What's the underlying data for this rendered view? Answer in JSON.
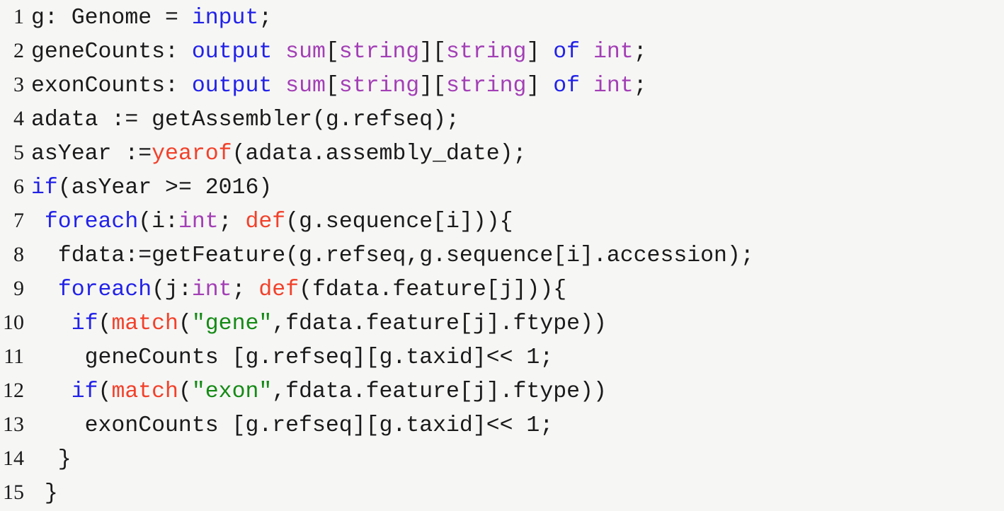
{
  "editor": {
    "background_color": "#f6f6f5",
    "default_text_color": "#1a1a1a",
    "language": "BoaLang"
  },
  "palette": {
    "plain": "#1a1a1a",
    "keyword": "#2222e8",
    "type": "#a33fb5",
    "builtin": "#f2412a",
    "string": "#158a15"
  },
  "lines": [
    {
      "number": "1",
      "text": "g: Genome = input;",
      "tokens": [
        {
          "t": "g: Genome = ",
          "c": "plain"
        },
        {
          "t": "input",
          "c": "keyword"
        },
        {
          "t": ";",
          "c": "plain"
        }
      ]
    },
    {
      "number": "2",
      "text": "geneCounts: output sum[string][string] of int;",
      "tokens": [
        {
          "t": "geneCounts: ",
          "c": "plain"
        },
        {
          "t": "output",
          "c": "keyword"
        },
        {
          "t": " ",
          "c": "plain"
        },
        {
          "t": "sum",
          "c": "type"
        },
        {
          "t": "[",
          "c": "plain"
        },
        {
          "t": "string",
          "c": "type"
        },
        {
          "t": "]",
          "c": "plain"
        },
        {
          "t": "[",
          "c": "plain"
        },
        {
          "t": "string",
          "c": "type"
        },
        {
          "t": "]",
          "c": "plain"
        },
        {
          "t": " ",
          "c": "plain"
        },
        {
          "t": "of",
          "c": "keyword"
        },
        {
          "t": " ",
          "c": "plain"
        },
        {
          "t": "int",
          "c": "type"
        },
        {
          "t": ";",
          "c": "plain"
        }
      ]
    },
    {
      "number": "3",
      "text": "exonCounts: output sum[string][string] of int;",
      "tokens": [
        {
          "t": "exonCounts: ",
          "c": "plain"
        },
        {
          "t": "output",
          "c": "keyword"
        },
        {
          "t": " ",
          "c": "plain"
        },
        {
          "t": "sum",
          "c": "type"
        },
        {
          "t": "[",
          "c": "plain"
        },
        {
          "t": "string",
          "c": "type"
        },
        {
          "t": "]",
          "c": "plain"
        },
        {
          "t": "[",
          "c": "plain"
        },
        {
          "t": "string",
          "c": "type"
        },
        {
          "t": "]",
          "c": "plain"
        },
        {
          "t": " ",
          "c": "plain"
        },
        {
          "t": "of",
          "c": "keyword"
        },
        {
          "t": " ",
          "c": "plain"
        },
        {
          "t": "int",
          "c": "type"
        },
        {
          "t": ";",
          "c": "plain"
        }
      ]
    },
    {
      "number": "4",
      "text": "adata := getAssembler(g.refseq);",
      "tokens": [
        {
          "t": "adata := getAssembler(g.refseq);",
          "c": "plain"
        }
      ]
    },
    {
      "number": "5",
      "text": "asYear :=yearof(adata.assembly_date);",
      "tokens": [
        {
          "t": "asYear :=",
          "c": "plain"
        },
        {
          "t": "yearof",
          "c": "builtin"
        },
        {
          "t": "(adata.assembly_date);",
          "c": "plain"
        }
      ]
    },
    {
      "number": "6",
      "text": "if(asYear >= 2016)",
      "tokens": [
        {
          "t": "if",
          "c": "keyword"
        },
        {
          "t": "(asYear >= 2016)",
          "c": "plain"
        }
      ]
    },
    {
      "number": "7",
      "text": " foreach(i:int; def(g.sequence[i])){",
      "tokens": [
        {
          "t": " ",
          "c": "plain"
        },
        {
          "t": "foreach",
          "c": "keyword"
        },
        {
          "t": "(i:",
          "c": "plain"
        },
        {
          "t": "int",
          "c": "type"
        },
        {
          "t": "; ",
          "c": "plain"
        },
        {
          "t": "def",
          "c": "builtin"
        },
        {
          "t": "(g.sequence[i])){",
          "c": "plain"
        }
      ]
    },
    {
      "number": "8",
      "text": "  fdata:=getFeature(g.refseq,g.sequence[i].accession);",
      "tokens": [
        {
          "t": "  fdata:=getFeature(g.refseq,g.sequence[i].accession);",
          "c": "plain"
        }
      ]
    },
    {
      "number": "9",
      "text": "  foreach(j:int; def(fdata.feature[j])){",
      "tokens": [
        {
          "t": "  ",
          "c": "plain"
        },
        {
          "t": "foreach",
          "c": "keyword"
        },
        {
          "t": "(j:",
          "c": "plain"
        },
        {
          "t": "int",
          "c": "type"
        },
        {
          "t": "; ",
          "c": "plain"
        },
        {
          "t": "def",
          "c": "builtin"
        },
        {
          "t": "(fdata.feature[j])){",
          "c": "plain"
        }
      ]
    },
    {
      "number": "10",
      "text": "   if(match(\"gene\",fdata.feature[j].ftype))",
      "tokens": [
        {
          "t": "   ",
          "c": "plain"
        },
        {
          "t": "if",
          "c": "keyword"
        },
        {
          "t": "(",
          "c": "plain"
        },
        {
          "t": "match",
          "c": "builtin"
        },
        {
          "t": "(",
          "c": "plain"
        },
        {
          "t": "\"gene\"",
          "c": "string"
        },
        {
          "t": ",fdata.feature[j].ftype))",
          "c": "plain"
        }
      ]
    },
    {
      "number": "11",
      "text": "    geneCounts [g.refseq][g.taxid]<< 1;",
      "tokens": [
        {
          "t": "    geneCounts [g.refseq][g.taxid]<< 1;",
          "c": "plain"
        }
      ]
    },
    {
      "number": "12",
      "text": "   if(match(\"exon\",fdata.feature[j].ftype))",
      "tokens": [
        {
          "t": "   ",
          "c": "plain"
        },
        {
          "t": "if",
          "c": "keyword"
        },
        {
          "t": "(",
          "c": "plain"
        },
        {
          "t": "match",
          "c": "builtin"
        },
        {
          "t": "(",
          "c": "plain"
        },
        {
          "t": "\"exon\"",
          "c": "string"
        },
        {
          "t": ",fdata.feature[j].ftype))",
          "c": "plain"
        }
      ]
    },
    {
      "number": "13",
      "text": "    exonCounts [g.refseq][g.taxid]<< 1;",
      "tokens": [
        {
          "t": "    exonCounts [g.refseq][g.taxid]<< 1;",
          "c": "plain"
        }
      ]
    },
    {
      "number": "14",
      "text": "  }",
      "tokens": [
        {
          "t": "  }",
          "c": "plain"
        }
      ]
    },
    {
      "number": "15",
      "text": " }",
      "tokens": [
        {
          "t": " }",
          "c": "plain"
        }
      ]
    }
  ]
}
